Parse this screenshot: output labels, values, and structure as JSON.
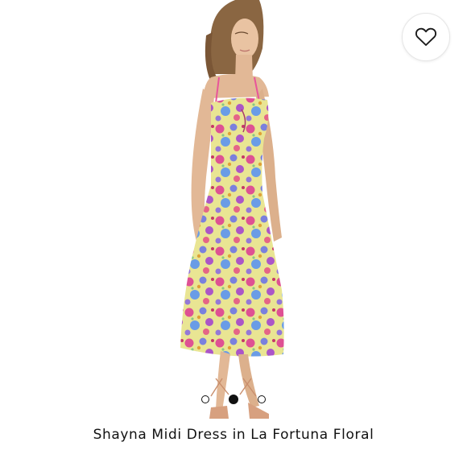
{
  "product": {
    "title": "Shayna Midi Dress in La Fortuna Floral"
  },
  "gallery": {
    "image_count": 3,
    "active_index": 1
  },
  "icons": {
    "favorite": "heart-outline-icon"
  },
  "colors": {
    "dot_active": "#111111",
    "dress_base": "#f3ef9a",
    "floral_pink": "#e8559a",
    "floral_blue": "#7f86e6",
    "floral_purple": "#b25ad0"
  }
}
